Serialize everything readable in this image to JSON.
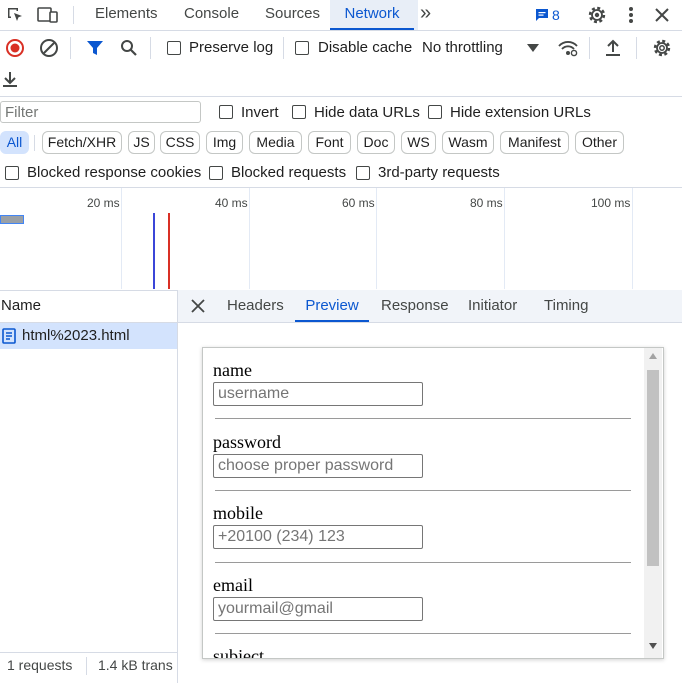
{
  "tabs": {
    "elements": "Elements",
    "console": "Console",
    "sources": "Sources",
    "network": "Network",
    "more": "»",
    "messages_count": "8"
  },
  "toolbar": {
    "preserve_log": "Preserve log",
    "disable_cache": "Disable cache",
    "throttling": "No throttling"
  },
  "filter": {
    "placeholder": "Filter",
    "invert": "Invert",
    "hide_data_urls": "Hide data URLs",
    "hide_extension_urls": "Hide extension URLs"
  },
  "type_filters": [
    "All",
    "Fetch/XHR",
    "JS",
    "CSS",
    "Img",
    "Media",
    "Font",
    "Doc",
    "WS",
    "Wasm",
    "Manifest",
    "Other"
  ],
  "options": {
    "blocked_cookies": "Blocked response cookies",
    "blocked_requests": "Blocked requests",
    "third_party": "3rd-party requests"
  },
  "timeline": {
    "ticks": [
      "20 ms",
      "40 ms",
      "60 ms",
      "80 ms",
      "100 ms"
    ]
  },
  "requests": {
    "header": "Name",
    "items": [
      "html%2023.html"
    ]
  },
  "detail_tabs": {
    "headers": "Headers",
    "preview": "Preview",
    "response": "Response",
    "initiator": "Initiator",
    "timing": "Timing"
  },
  "status": {
    "requests": "1 requests",
    "transferred": "1.4 kB trans"
  },
  "preview": {
    "fields": [
      {
        "label": "name",
        "placeholder": "username"
      },
      {
        "label": "password",
        "placeholder": "choose proper password"
      },
      {
        "label": "mobile",
        "placeholder": "+20100 (234) 123"
      },
      {
        "label": "email",
        "placeholder": "yourmail@gmail"
      },
      {
        "label": "subject"
      }
    ]
  },
  "colors": {
    "accent": "#0b57d0",
    "record_red": "#d93025",
    "chip_active_bg": "#d3e3fd"
  }
}
